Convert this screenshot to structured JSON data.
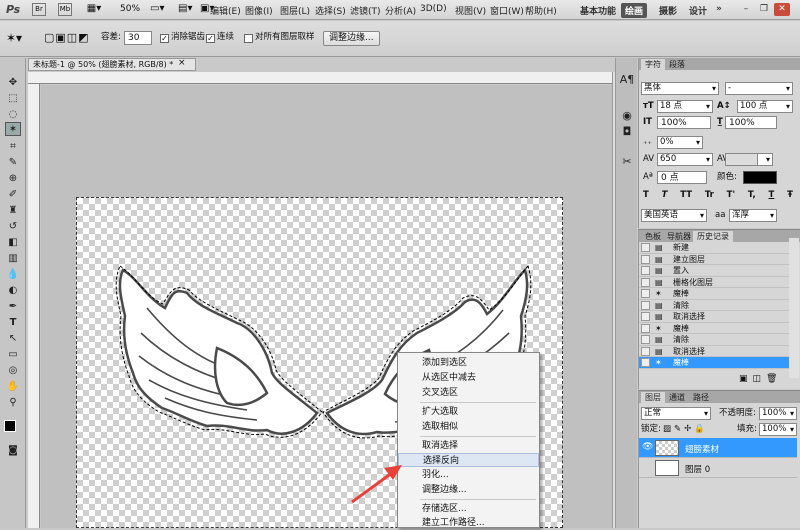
{
  "app": {
    "logo": "Ps"
  },
  "menu": [
    "编辑(E)",
    "图像(I)",
    "图层(L)",
    "选择(S)",
    "滤镜(T)",
    "分析(A)",
    "3D(D)",
    "视图(V)",
    "窗口(W)",
    "帮助(H)"
  ],
  "topbar": {
    "zoom": "50%",
    "workspace_basic": "基本功能",
    "workspace_paint": "绘画",
    "workspace_photo": "摄影",
    "workspace_design": "设计",
    "more": "»"
  },
  "options": {
    "tolerance_label": "容差:",
    "tolerance_value": "30",
    "antialias_label": "消除锯齿",
    "contiguous_label": "连续",
    "all_layers_label": "对所有图层取样",
    "refine_edge_button": "调整边缘..."
  },
  "document": {
    "tab_title": "未标题-1 @ 50% (翅膀素材, RGB/8) *",
    "tab_close": "×"
  },
  "context_menu": {
    "items": [
      "添加到选区",
      "从选区中减去",
      "交叉选区",
      "扩大选取",
      "选取相似",
      "取消选择",
      "选择反向",
      "羽化...",
      "调整边缘...",
      "存储选区...",
      "建立工作路径..."
    ],
    "highlighted_index": 6
  },
  "character_panel": {
    "tabs": [
      "字符",
      "段落"
    ],
    "font_family": "黑体",
    "font_style": "-",
    "font_size": "18 点",
    "leading": "100 点",
    "vertical_scale": "100%",
    "horizontal_scale": "100%",
    "tracking_pct": "0%",
    "tracking": "650",
    "baseline_shift": "0 点",
    "color_label": "颜色:",
    "color": "#000000",
    "style_buttons": [
      "T",
      "T",
      "TT",
      "Tr",
      "T'",
      "T,",
      "T",
      "Ŧ"
    ],
    "language": "美国英语",
    "antialias_icon": "aa",
    "antialias": "浑厚"
  },
  "history_panel": {
    "tabs": [
      "色板",
      "导航器",
      "历史记录"
    ],
    "items": [
      "新建",
      "建立图层",
      "置入",
      "栅格化图层",
      "魔棒",
      "清除",
      "取消选择",
      "魔棒",
      "清除",
      "取消选择",
      "魔棒"
    ],
    "selected_index": 10
  },
  "layers_panel": {
    "tabs": [
      "图层",
      "通道",
      "路径"
    ],
    "blend_mode": "正常",
    "opacity_label": "不透明度:",
    "opacity": "100%",
    "lock_label": "锁定:",
    "fill_label": "填充:",
    "fill": "100%",
    "layers": [
      {
        "name": "翅膀素材",
        "selected": true
      },
      {
        "name": "图层 0",
        "selected": false
      }
    ]
  },
  "colors": {
    "highlight": "#3399ff",
    "arrow": "#e8413a"
  }
}
